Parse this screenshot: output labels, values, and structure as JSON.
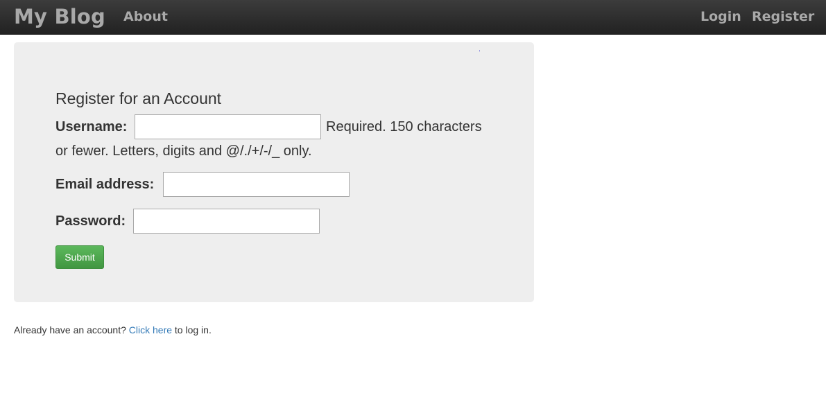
{
  "navbar": {
    "brand": "My Blog",
    "about": "About",
    "login": "Login",
    "register": "Register"
  },
  "form": {
    "title": "Register for an Account",
    "username_label": "Username:",
    "username_value": "",
    "username_help_line1": "Required. 150 characters",
    "username_help_line2": "or fewer. Letters, digits and @/./+/-/_ only.",
    "email_label": "Email address:",
    "email_value": "",
    "password_label": "Password:",
    "password_value": "",
    "submit_label": "Submit"
  },
  "footer": {
    "prefix": "Already have an account?",
    "link": "Click here",
    "suffix": "to log in."
  },
  "colors": {
    "navbar_bg": "#222222",
    "nav_text": "#a9a9a9",
    "panel_bg": "#eeeeee",
    "submit_bg": "#5cb85c",
    "link": "#337ab7"
  }
}
